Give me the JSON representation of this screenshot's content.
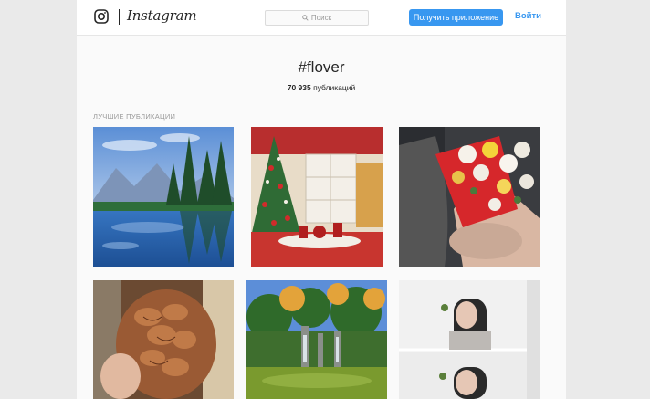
{
  "header": {
    "brand": "Instagram",
    "search_placeholder": "Поиск",
    "get_app_label": "Получить приложение",
    "login_label": "Войти"
  },
  "hashtag": {
    "title": "#flover",
    "count": "70 935",
    "count_suffix": " публикаций"
  },
  "section": {
    "top_posts_label": "ЛУЧШИЕ ПУБЛИКАЦИИ"
  },
  "colors": {
    "accent": "#3897f0",
    "text": "#262626",
    "muted": "#999999"
  },
  "posts": [
    {
      "subject": "mountain-lake"
    },
    {
      "subject": "christmas-tree"
    },
    {
      "subject": "flower-bouquet"
    },
    {
      "subject": "braided-hair"
    },
    {
      "subject": "garden-waterfall"
    },
    {
      "subject": "woman-portrait"
    }
  ]
}
